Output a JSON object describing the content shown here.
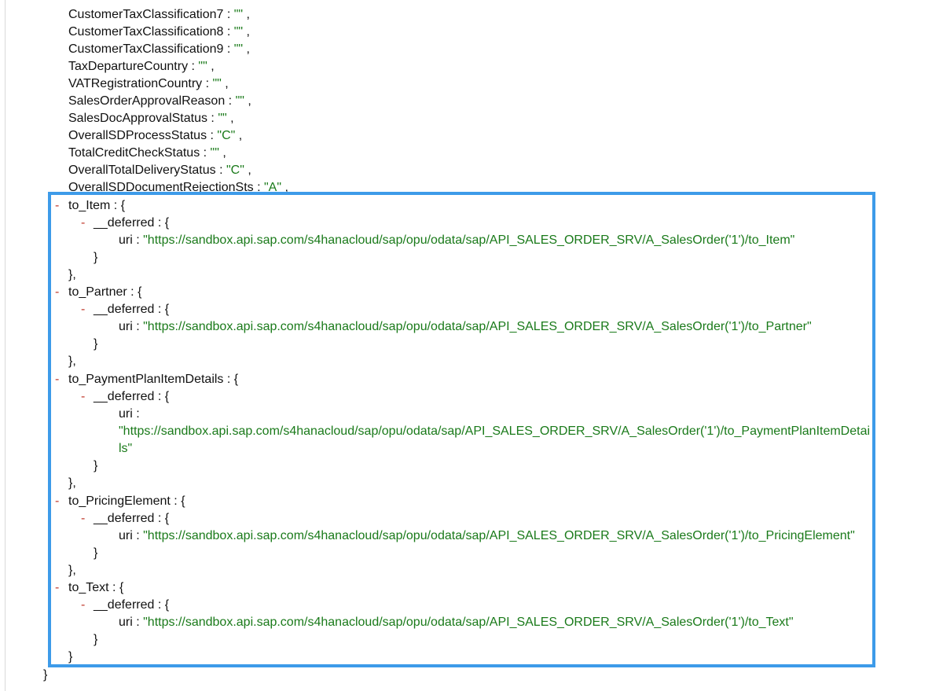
{
  "top_fields": [
    {
      "key": "CustomerTaxClassification7",
      "value": "\"\""
    },
    {
      "key": "CustomerTaxClassification8",
      "value": "\"\""
    },
    {
      "key": "CustomerTaxClassification9",
      "value": "\"\""
    },
    {
      "key": "TaxDepartureCountry",
      "value": "\"\""
    },
    {
      "key": "VATRegistrationCountry",
      "value": "\"\""
    },
    {
      "key": "SalesOrderApprovalReason",
      "value": "\"\""
    },
    {
      "key": "SalesDocApprovalStatus",
      "value": "\"\""
    },
    {
      "key": "OverallSDProcessStatus",
      "value": "\"C\""
    },
    {
      "key": "TotalCreditCheckStatus",
      "value": "\"\""
    },
    {
      "key": "OverallTotalDeliveryStatus",
      "value": "\"C\""
    },
    {
      "key": "OverallSDDocumentRejectionSts",
      "value": "\"A\""
    }
  ],
  "syntax": {
    "colon": " : ",
    "comma": " ,",
    "open_brace": " {",
    "close_brace": "}",
    "close_brace_comma": "},",
    "collapse_toggle": "-",
    "deferred_key": "__deferred",
    "uri_key": "uri"
  },
  "nav_props": [
    {
      "key": "to_Item",
      "uri": "\"https://sandbox.api.sap.com/s4hanacloud/sap/opu/odata/sap/API_SALES_ORDER_SRV/A_SalesOrder('1')/to_Item\""
    },
    {
      "key": "to_Partner",
      "uri": "\"https://sandbox.api.sap.com/s4hanacloud/sap/opu/odata/sap/API_SALES_ORDER_SRV/A_SalesOrder('1')/to_Partner\""
    },
    {
      "key": "to_PaymentPlanItemDetails",
      "uri_line1": "\"https://sandbox.api.sap.com/s4hanacloud/sap/opu/odata/sap/API_SALES_ORDER_SRV/A_SalesOrder('1')/to_PaymentPlanItemDetai",
      "uri_line2": "ls\""
    },
    {
      "key": "to_PricingElement",
      "uri": "\"https://sandbox.api.sap.com/s4hanacloud/sap/opu/odata/sap/API_SALES_ORDER_SRV/A_SalesOrder('1')/to_PricingElement\""
    },
    {
      "key": "to_Text",
      "uri": "\"https://sandbox.api.sap.com/s4hanacloud/sap/opu/odata/sap/API_SALES_ORDER_SRV/A_SalesOrder('1')/to_Text\""
    }
  ],
  "highlight_color": "#3d9be9",
  "string_color": "#1a7a1a",
  "toggle_color": "#c0392b"
}
